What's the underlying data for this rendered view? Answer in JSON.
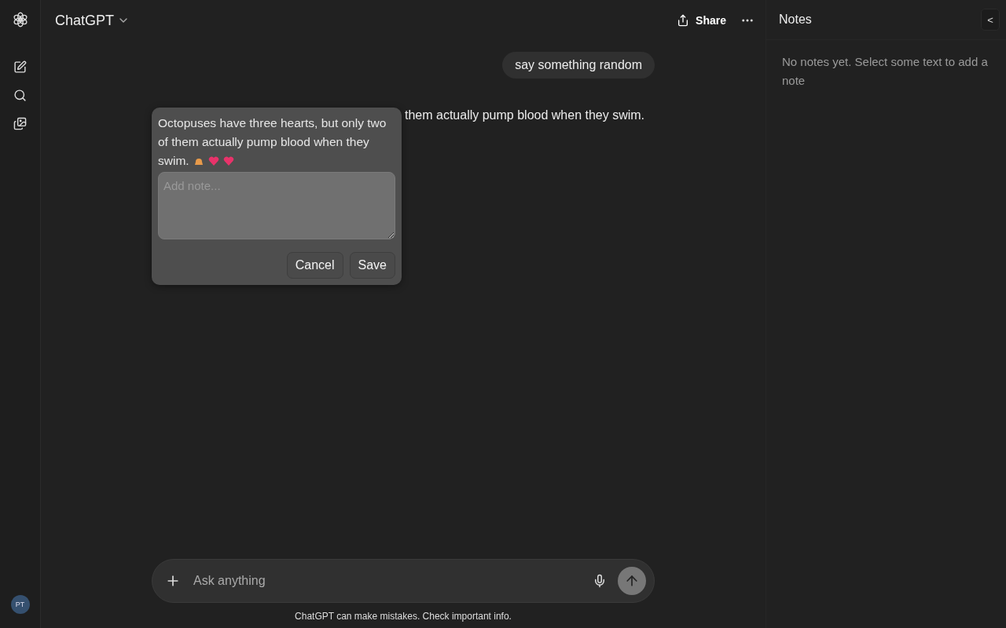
{
  "header": {
    "title": "ChatGPT",
    "share": "Share"
  },
  "messages": [
    {
      "kind": "user",
      "text": "say something random"
    },
    {
      "kind": "assistant",
      "text": "them actually pump blood when they swim."
    }
  ],
  "note_popup": {
    "quote": "Octopuses have three hearts, but only two of them actually pump blood when they swim.",
    "placeholder": "Add note...",
    "buttons": [
      "Cancel",
      "Save"
    ]
  },
  "composer": {
    "placeholder": "Ask anything",
    "disclaimer": "ChatGPT can make mistakes. Check important info."
  },
  "user": {
    "initials": "PT"
  },
  "notes_panel": {
    "title": "Notes",
    "collapse": "<",
    "empty": "No notes yet. Select some text to add a note"
  }
}
